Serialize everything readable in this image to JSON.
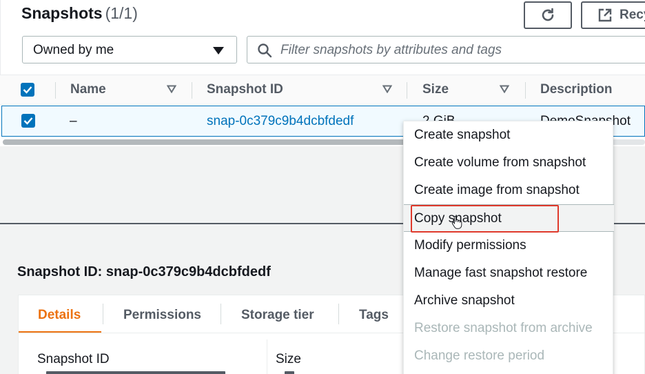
{
  "header": {
    "title": "Snapshots",
    "count": "(1/1)",
    "refresh_icon": "refresh-icon",
    "recycle_label": "Recy",
    "filter_select": {
      "value": "Owned by me"
    },
    "search": {
      "placeholder": "Filter snapshots by attributes and tags"
    }
  },
  "table": {
    "columns": [
      "Name",
      "Snapshot ID",
      "Size",
      "Description"
    ],
    "rows": [
      {
        "name": "–",
        "snapshot_id": "snap-0c379c9b4dcbfdedf",
        "size": "2 GiB",
        "description": "DemoSnapshot"
      }
    ]
  },
  "context_menu": {
    "items": [
      {
        "label": "Create snapshot",
        "enabled": true
      },
      {
        "label": "Create volume from snapshot",
        "enabled": true
      },
      {
        "label": "Create image from snapshot",
        "enabled": true
      },
      {
        "label": "Copy snapshot",
        "enabled": true,
        "hovered": true
      },
      {
        "label": "Modify permissions",
        "enabled": true
      },
      {
        "label": "Manage fast snapshot restore",
        "enabled": true
      },
      {
        "label": "Archive snapshot",
        "enabled": true
      },
      {
        "label": "Restore snapshot from archive",
        "enabled": false
      },
      {
        "label": "Change restore period",
        "enabled": false
      }
    ]
  },
  "details": {
    "title": "Snapshot ID: snap-0c379c9b4dcbfdedf",
    "tabs": [
      "Details",
      "Permissions",
      "Storage tier",
      "Tags"
    ],
    "active_tab": "Details",
    "fields": [
      "Snapshot ID",
      "Size"
    ]
  },
  "colors": {
    "accent": "#0073bb",
    "active_tab": "#ec7211",
    "highlight": "#e0392b"
  }
}
